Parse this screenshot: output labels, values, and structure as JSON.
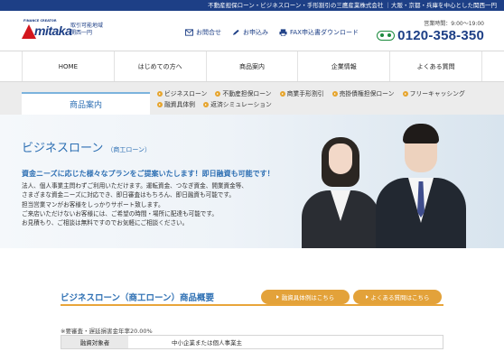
{
  "topbar": {
    "text": "不動産担保ローン・ビジネスローン・手形割引の三鷹産業株式会社 ｜大阪・京都・兵庫を中心とした関西一円"
  },
  "logo": {
    "sub": "FINANCE CREATOR",
    "word": "mitaka",
    "area_line1": "取引可能地域",
    "area_line2": "関西一円"
  },
  "header_nav": [
    {
      "label": "お問合せ",
      "icon": "mail-icon"
    },
    {
      "label": "お申込み",
      "icon": "pen-icon"
    },
    {
      "label": "FAX申込書ダウンロード",
      "icon": "printer-icon"
    }
  ],
  "phone": {
    "hours": "営業時間：9:00〜19:00",
    "number": "0120-358-350",
    "icon": "freedial-icon"
  },
  "main_nav": [
    "HOME",
    "はじめての方へ",
    "商品案内",
    "企業情報",
    "よくある質問"
  ],
  "subnav": {
    "tab": "商品案内",
    "links": [
      "ビジネスローン",
      "不動産担保ローン",
      "商業手形割引",
      "売掛債権担保ローン",
      "フリーキャッシング",
      "融資具体例",
      "返済シミュレーション"
    ]
  },
  "hero": {
    "title": "ビジネスローン",
    "title_sub": "（商工ローン）",
    "tagline": "資金ニーズに応じた様々なプランをご提案いたします！即日融資も可能です！",
    "body": [
      "法人、個人事業主問わずご利用いただけます。運転資金、つなぎ資金、開業資金等、",
      "さまざまな資金ニーズに対応でき、即日審査はもちろん、即日融資も可能です。",
      "担当営業マンがお客様をしっかりサポート致します。",
      "ご来店いただけないお客様には、ご希望の時間・場所に配達も可能です。",
      "お見積もり、ご相談は無料ですのでお気軽にご相談ください。"
    ]
  },
  "section": {
    "title": "ビジネスローン（商工ローン）商品概要",
    "btn_case": "融資具体例はこちら",
    "btn_faq": "よくある質問はこちら",
    "note": "※要審査・遅延損害金年率20.00%",
    "table": [
      {
        "header": "融資対象者",
        "value": "中小企業または個人事業主"
      }
    ]
  },
  "colors": {
    "brand_blue": "#1d3f86",
    "accent_orange": "#e3a23a",
    "link_blue": "#2d6fb3",
    "logo_red": "#d3161d"
  }
}
